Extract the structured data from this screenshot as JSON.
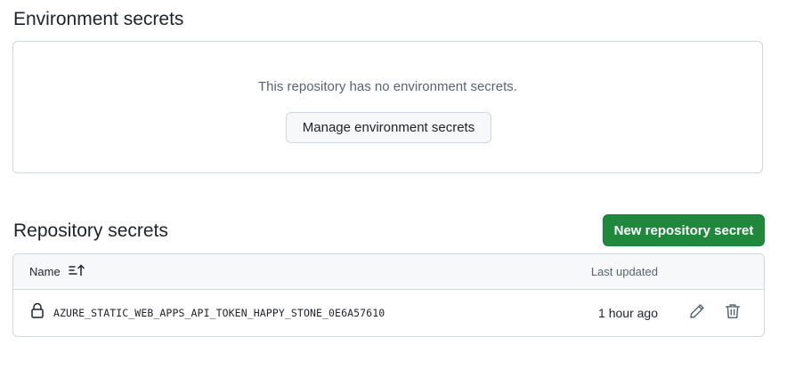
{
  "environment_secrets": {
    "title": "Environment secrets",
    "empty_message": "This repository has no environment secrets.",
    "manage_button_label": "Manage environment secrets"
  },
  "repository_secrets": {
    "title": "Repository secrets",
    "new_button_label": "New repository secret",
    "columns": {
      "name": "Name",
      "last_updated": "Last updated"
    },
    "rows": [
      {
        "name": "AZURE_STATIC_WEB_APPS_API_TOKEN_HAPPY_STONE_0E6A57610",
        "updated": "1 hour ago",
        "icon": "lock-icon",
        "actions": [
          "pencil-icon",
          "trash-icon"
        ]
      }
    ]
  },
  "colors": {
    "primary_button": "#1f883d",
    "border": "#d0d7de",
    "muted_text": "#59636e"
  }
}
